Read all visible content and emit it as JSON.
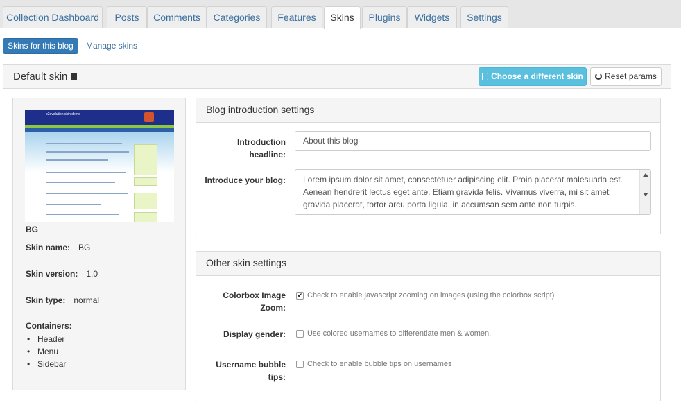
{
  "tabs": [
    {
      "label": "Collection Dashboard",
      "active": false
    },
    {
      "label": "Posts",
      "active": false
    },
    {
      "label": "Comments",
      "active": false
    },
    {
      "label": "Categories",
      "active": false
    },
    {
      "label": "Features",
      "active": false
    },
    {
      "label": "Skins",
      "active": true
    },
    {
      "label": "Plugins",
      "active": false
    },
    {
      "label": "Widgets",
      "active": false
    },
    {
      "label": "Settings",
      "active": false
    }
  ],
  "subnav": {
    "active_label": "Skins for this blog",
    "link_label": "Manage skins"
  },
  "panel": {
    "title": "Default skin",
    "choose_button": "Choose a different skin »",
    "reset_button": "Reset params"
  },
  "skin": {
    "name_heading": "BG",
    "name_label": "Skin name:",
    "name_value": "BG",
    "version_label": "Skin version:",
    "version_value": "1.0",
    "type_label": "Skin type:",
    "type_value": "normal",
    "containers_label": "Containers:",
    "containers": [
      "Header",
      "Menu",
      "Sidebar"
    ],
    "thumbnail_title": "b2evolution skin demo"
  },
  "intro_settings": {
    "heading": "Blog introduction settings",
    "headline_label": "Introduction headline:",
    "headline_value": "About this blog",
    "intro_label": "Introduce your blog:",
    "intro_value": "Lorem ipsum dolor sit amet, consectetuer adipiscing elit. Proin placerat malesuada est. Aenean hendrerit lectus eget ante. Etiam gravida felis. Vivamus viverra, mi sit amet gravida placerat, tortor arcu porta ligula, in accumsan sem ante non turpis."
  },
  "other_settings": {
    "heading": "Other skin settings",
    "colorbox_label": "Colorbox Image Zoom:",
    "colorbox_text": "Check to enable javascript zooming on images (using the colorbox script)",
    "colorbox_checked": true,
    "gender_label": "Display gender:",
    "gender_text": "Use colored usernames to differentiate men & women.",
    "gender_checked": false,
    "bubble_label": "Username bubble tips:",
    "bubble_text": "Check to enable bubble tips on usernames",
    "bubble_checked": false
  },
  "colors": {
    "primary": "#337ab7",
    "info": "#5bc0de",
    "link": "#3a6f9f"
  }
}
